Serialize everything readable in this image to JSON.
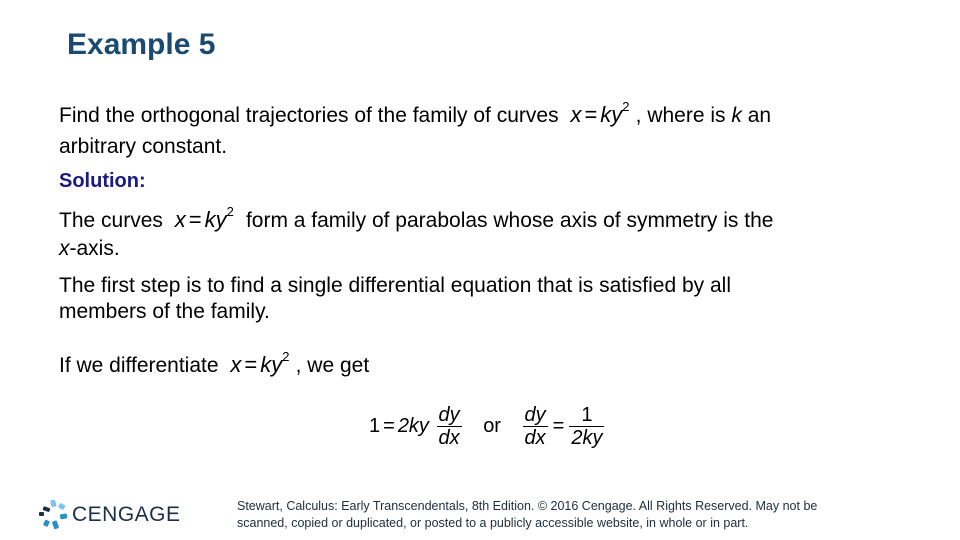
{
  "slide": {
    "title": "Example 5",
    "problem": {
      "line1_text": "Find the orthogonal trajectories of the family of curves",
      "line1_after": ", where is",
      "k": "k",
      "line1_end": "an",
      "line2": "arbitrary constant."
    },
    "solution_label": "Solution:",
    "para1": {
      "start": "The curves",
      "end": "form a family of parabolas whose axis of symmetry is the",
      "line2_var": "x",
      "line2_rest": "-axis."
    },
    "para2": {
      "line1": "The first step is to find a single differential equation that is satisfied by all",
      "line2": "members of the family."
    },
    "para3": {
      "start": "If we differentiate",
      "end": ", we get"
    },
    "equation": {
      "x": "x",
      "equals": "=",
      "k": "k",
      "y": "y",
      "exponent": "2"
    },
    "derivative": {
      "lhs_one": "1",
      "equals": "=",
      "coef": "2ky",
      "dy": "dy",
      "dx": "dx",
      "or": "or",
      "num_one": "1",
      "den": "2ky"
    }
  },
  "footer": {
    "brand": "CENGAGE",
    "copyright_line1": "Stewart, Calculus: Early Transcendentals, 8th Edition. © 2016 Cengage. All Rights Reserved. May not be",
    "copyright_line2": "scanned, copied or duplicated, or posted to a publicly accessible website, in whole or in part."
  },
  "colors": {
    "title": "#1a4a70",
    "solution": "#1a1a80",
    "logo_dark": "#1b2f4a",
    "logo_blue": "#2a8fc9",
    "logo_light": "#7cc3ea"
  }
}
